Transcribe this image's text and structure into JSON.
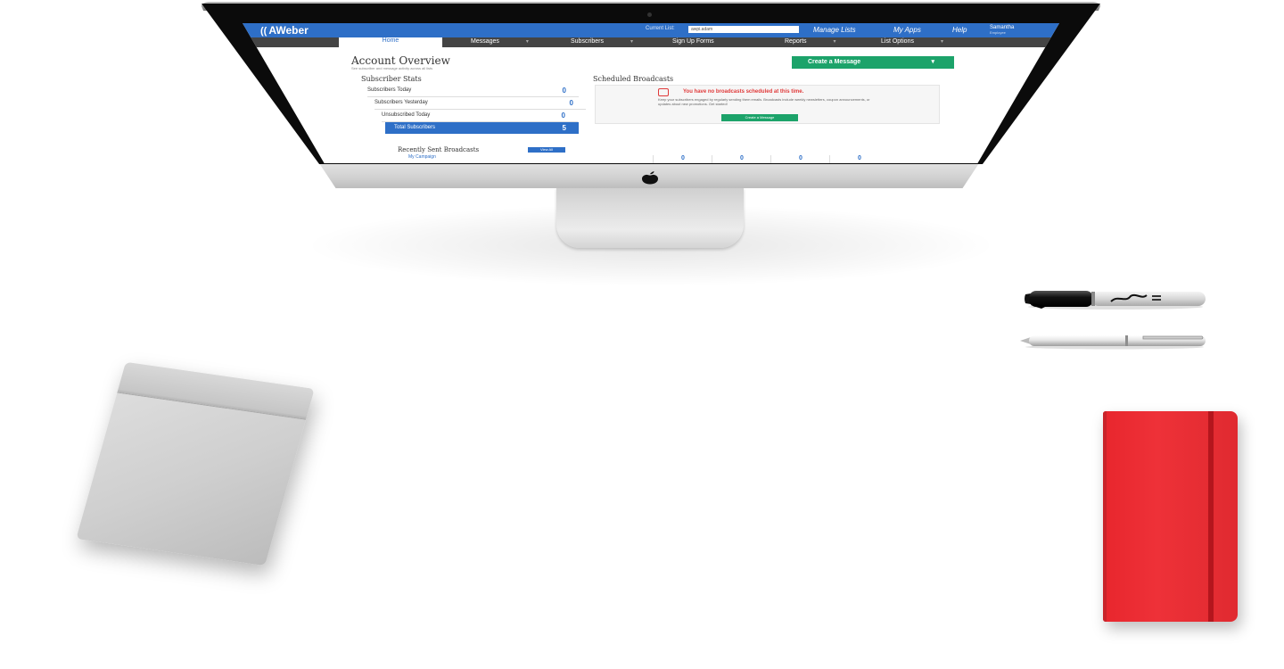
{
  "brand": {
    "name": "AWeber",
    "accent": "#2e6fc7",
    "green": "#1ca36a",
    "alert": "#e03a3a"
  },
  "header": {
    "current_list_label": "Current List:",
    "current_list_value": "awpi.adam",
    "links": [
      "Manage Lists",
      "My Apps",
      "Help"
    ],
    "user_name": "Samantha",
    "user_sub": "Employee"
  },
  "nav": {
    "items": [
      "Home",
      "Messages",
      "Subscribers",
      "Sign Up Forms",
      "Reports",
      "List Options"
    ]
  },
  "overview": {
    "title": "Account Overview",
    "subtitle": "See subscriber and message activity across all lists",
    "create_button": "Create a Message"
  },
  "stats": {
    "title": "Subscriber Stats",
    "rows": [
      {
        "label": "Subscribers Today",
        "value": "0"
      },
      {
        "label": "Subscribers Yesterday",
        "value": "0"
      },
      {
        "label": "Unsubscribed Today",
        "value": "0"
      },
      {
        "label": "Total Subscribers",
        "value": "5"
      }
    ]
  },
  "scheduled": {
    "title": "Scheduled Broadcasts",
    "warning": "You have no broadcasts scheduled at this time.",
    "message": "Keep your subscribers engaged by regularly sending them emails. Broadcasts include weekly newsletters, coupon announcements, or updates about new promotions. Get started!",
    "button": "Create a Message"
  },
  "recent": {
    "title": "Recently Sent Broadcasts",
    "button": "View All",
    "item": "My Campaign",
    "mini_stats": [
      "0",
      "0",
      "0",
      "0"
    ]
  }
}
